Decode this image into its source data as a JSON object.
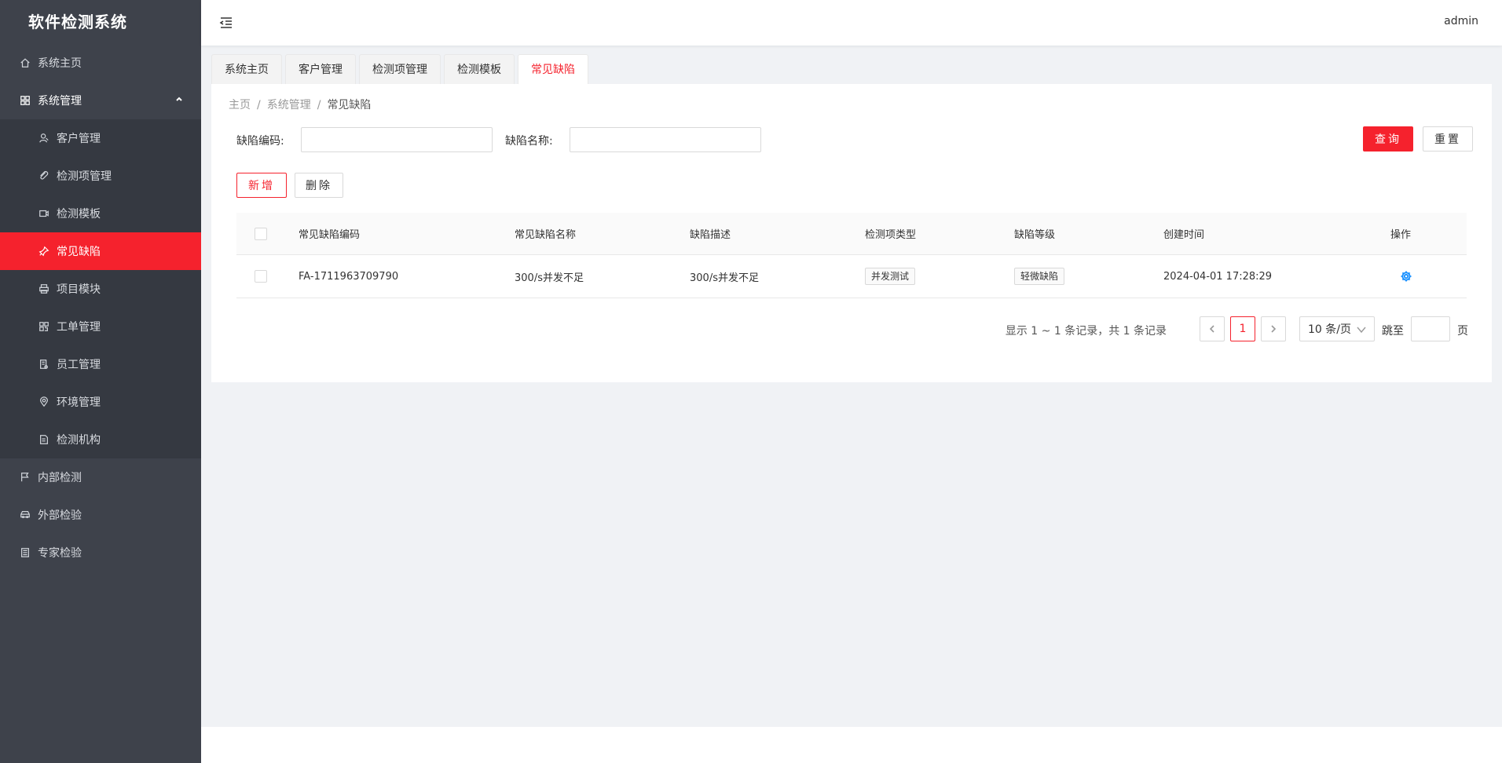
{
  "app": {
    "title": "软件检测系统"
  },
  "header": {
    "user": "admin"
  },
  "sidebar": {
    "items": [
      {
        "label": "系统主页",
        "icon": "home-icon"
      },
      {
        "label": "系统管理",
        "icon": "grid-icon",
        "expanded": true,
        "children": [
          {
            "label": "客户管理",
            "icon": "user-icon"
          },
          {
            "label": "检测项管理",
            "icon": "link-icon"
          },
          {
            "label": "检测模板",
            "icon": "video-icon"
          },
          {
            "label": "常见缺陷",
            "icon": "pin-icon",
            "active": true
          },
          {
            "label": "项目模块",
            "icon": "printer-icon"
          },
          {
            "label": "工单管理",
            "icon": "qrcode-icon"
          },
          {
            "label": "员工管理",
            "icon": "doc-icon"
          },
          {
            "label": "环境管理",
            "icon": "location-icon"
          },
          {
            "label": "检测机构",
            "icon": "file-icon"
          }
        ]
      },
      {
        "label": "内部检测",
        "icon": "flag-icon"
      },
      {
        "label": "外部检验",
        "icon": "car-icon"
      },
      {
        "label": "专家检验",
        "icon": "list-icon"
      }
    ]
  },
  "tabs": [
    {
      "label": "系统主页"
    },
    {
      "label": "客户管理"
    },
    {
      "label": "检测项管理"
    },
    {
      "label": "检测模板"
    },
    {
      "label": "常见缺陷",
      "active": true
    }
  ],
  "breadcrumb": {
    "home": "主页",
    "parent": "系统管理",
    "current": "常见缺陷",
    "separator": "/"
  },
  "search": {
    "code_label": "缺陷编码:",
    "code_value": "",
    "name_label": "缺陷名称:",
    "name_value": "",
    "query_label": "查询",
    "reset_label": "重置"
  },
  "toolbar": {
    "add_label": "新增",
    "delete_label": "删除"
  },
  "table": {
    "columns": [
      "常见缺陷编码",
      "常见缺陷名称",
      "缺陷描述",
      "检测项类型",
      "缺陷等级",
      "创建时间",
      "操作"
    ],
    "rows": [
      {
        "code": "FA-1711963709790",
        "name": "300/s并发不足",
        "description": "300/s并发不足",
        "type": "并发测试",
        "level": "轻微缺陷",
        "created": "2024-04-01 17:28:29",
        "action_icon": "gear-icon"
      }
    ]
  },
  "pagination": {
    "total_text": "显示 1 ~ 1 条记录，共 1 条记录",
    "current_page": "1",
    "page_size": "10 条/页",
    "jump_label": "跳至",
    "page_suffix": "页"
  },
  "colors": {
    "accent": "#f5222d",
    "sidebar_bg": "#3e424b",
    "link": "#1890ff"
  }
}
